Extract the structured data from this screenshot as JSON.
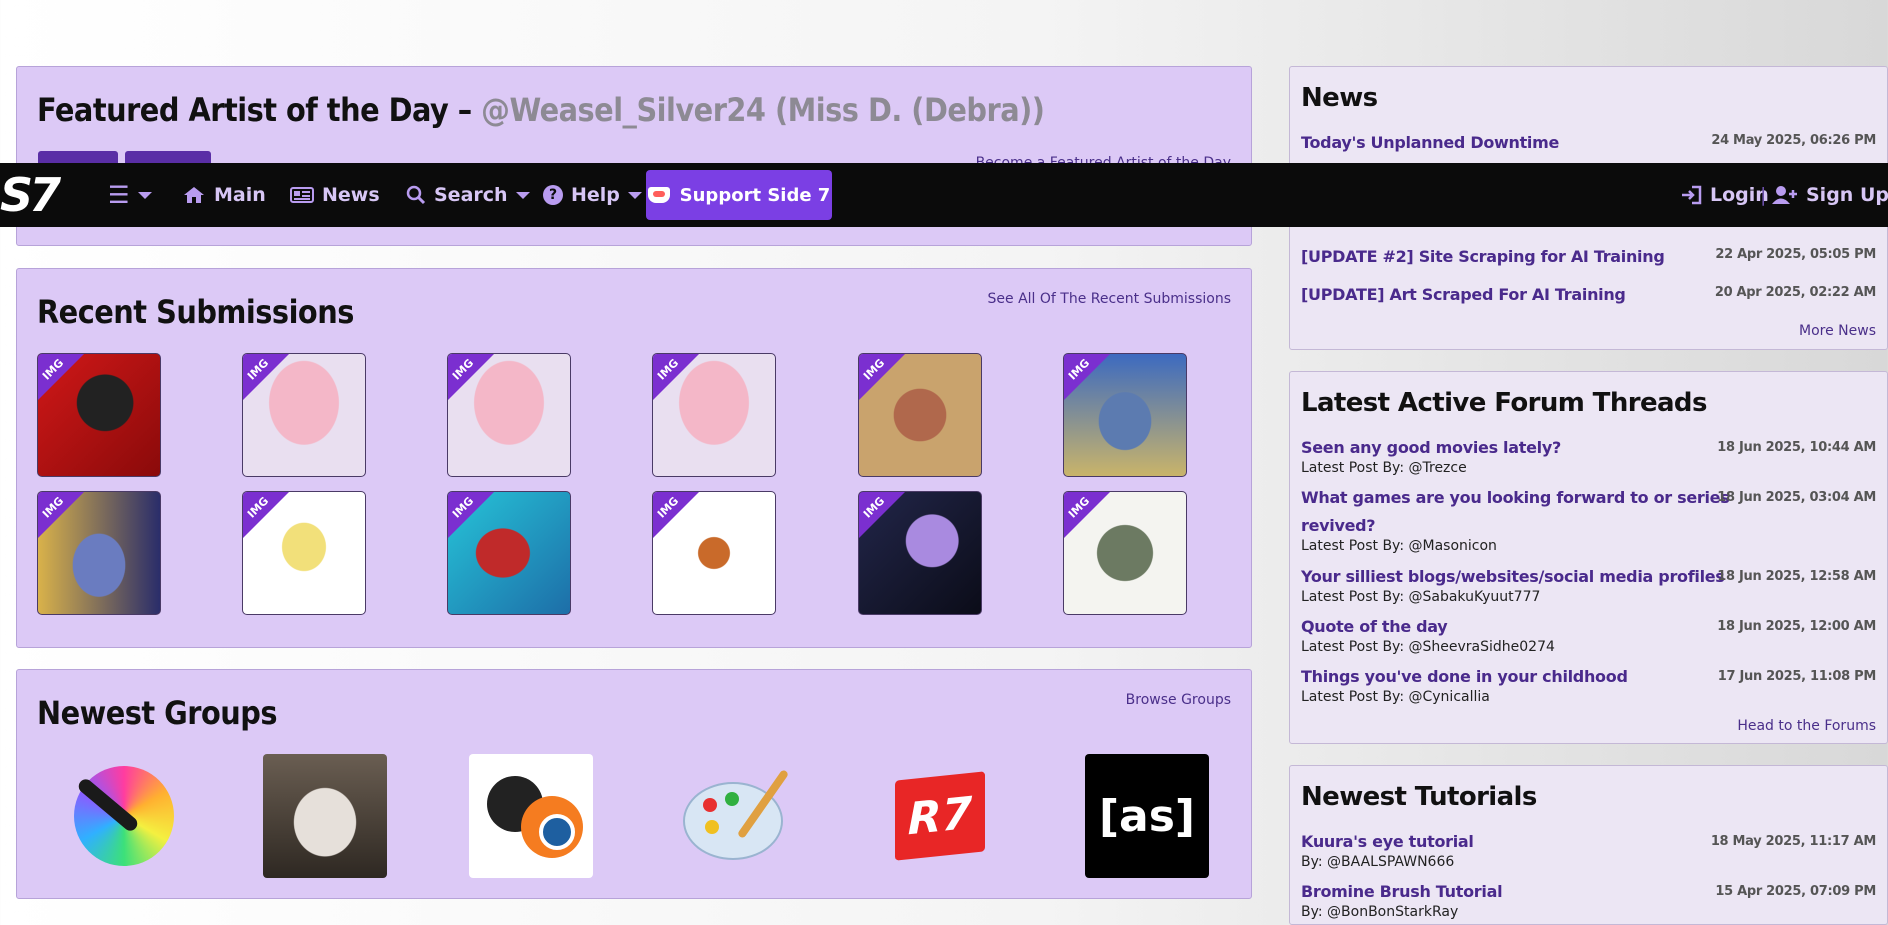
{
  "featured": {
    "title": "Featured Artist of the Day –",
    "artist": "@Weasel_Silver24 (Miss D. (Debra))",
    "become_link": "Become a Featured Artist of the Day"
  },
  "nav": {
    "logo": "S7",
    "main": "Main",
    "news": "News",
    "search": "Search",
    "help": "Help",
    "support": "Support Side 7",
    "login": "Login",
    "separator": "|",
    "signup": "Sign Up"
  },
  "recent": {
    "title": "Recent Submissions",
    "see_all": "See All Of The Recent Submissions",
    "badge": "IMG"
  },
  "groups": {
    "title": "Newest Groups",
    "browse": "Browse Groups",
    "as_logo": "[as]"
  },
  "news": {
    "title": "News",
    "items": [
      {
        "title": "Today's Unplanned Downtime",
        "date": "24 May 2025, 06:26 PM"
      },
      {
        "title": "[UPDATE #2] Site Scraping for AI Training",
        "date": "22 Apr 2025, 05:05 PM"
      },
      {
        "title": "[UPDATE] Art Scraped For AI Training",
        "date": "20 Apr 2025, 02:22 AM"
      }
    ],
    "more": "More News"
  },
  "forums": {
    "title": "Latest Active Forum Threads",
    "items": [
      {
        "title": "Seen any good movies lately?",
        "date": "18 Jun 2025, 10:44 AM",
        "by": "Latest Post By: @Trezce"
      },
      {
        "title": "What games are you looking forward to or series",
        "title2": "revived?",
        "date": "18 Jun 2025, 03:04 AM",
        "by": "Latest Post By: @Masonicon"
      },
      {
        "title": "Your silliest blogs/websites/social media profiles",
        "date": "18 Jun 2025, 12:58 AM",
        "by": "Latest Post By: @SabakuKyuut777"
      },
      {
        "title": "Quote of the day",
        "date": "18 Jun 2025, 12:00 AM",
        "by": "Latest Post By: @SheevraSidhe0274"
      },
      {
        "title": "Things you've done in your childhood",
        "date": "17 Jun 2025, 11:08 PM",
        "by": "Latest Post By: @Cynicallia"
      }
    ],
    "head": "Head to the Forums"
  },
  "tutorials": {
    "title": "Newest Tutorials",
    "items": [
      {
        "title": "Kuura's eye tutorial",
        "date": "18 May 2025, 11:17 AM",
        "by": "By: @BAALSPAWN666"
      },
      {
        "title": "Bromine Brush Tutorial",
        "date": "15 Apr 2025, 07:09 PM",
        "by": "By: @BonBonStarkRay"
      }
    ]
  },
  "colors": {
    "panel": "#dcc9f6",
    "accent": "#7b3fe4",
    "link": "#4a2a8c",
    "navbar": "#0b0b0b",
    "badge": "#7b2fd0"
  }
}
